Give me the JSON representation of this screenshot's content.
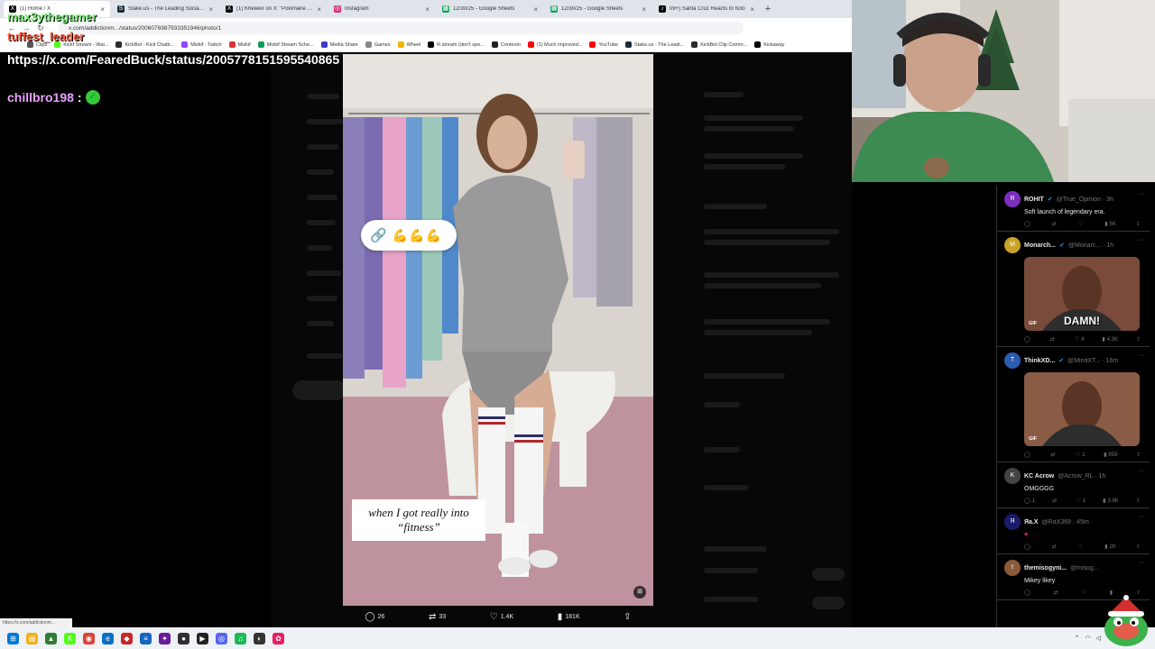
{
  "browser": {
    "tabs": [
      {
        "title": "(1) Home / X",
        "fav": "X",
        "color": "#000"
      },
      {
        "title": "Stake.us - The Leading Social C",
        "fav": "S",
        "color": "#1a2c38"
      },
      {
        "title": "(1) Kheweir on X: \"Pokimane say",
        "fav": "X",
        "color": "#000"
      },
      {
        "title": "Instagram",
        "fav": "◎",
        "color": "#d62976"
      },
      {
        "title": "12/30/25 - Google Sheets",
        "fav": "▦",
        "color": "#0f9d58"
      },
      {
        "title": "12/30/25 - Google Sheets",
        "fav": "▦",
        "color": "#0f9d58"
      },
      {
        "title": "09+) Santa Cruz Reacts to N3o",
        "fav": "♪",
        "color": "#000"
      }
    ],
    "new_tab": "+",
    "close_glyph": "×",
    "url": "x.com/addictionm.../status/2006076987933351946/photo/1",
    "bookmarks": [
      {
        "label": "Clips",
        "color": "#555"
      },
      {
        "label": "Kickf Stream - Wat...",
        "color": "#53fc18"
      },
      {
        "label": "KickBot - Kick Chatb...",
        "color": "#2b2b2b"
      },
      {
        "label": "Mizkif - Twitch",
        "color": "#9146ff"
      },
      {
        "label": "Mizkif",
        "color": "#d33"
      },
      {
        "label": "Mizkif Stream Sche...",
        "color": "#0f9d58"
      },
      {
        "label": "Media Share",
        "color": "#3b3bbd"
      },
      {
        "label": "Games",
        "color": "#888"
      },
      {
        "label": "Wheel",
        "color": "#f4b400"
      },
      {
        "label": "R.stream (don't ope...",
        "color": "#000"
      },
      {
        "label": "Contexto",
        "color": "#222"
      },
      {
        "label": "(1) Much improved...",
        "color": "#ff0000"
      },
      {
        "label": "YouTube",
        "color": "#ff0000"
      },
      {
        "label": "Stake.us - The Leadi...",
        "color": "#1a2c38"
      },
      {
        "label": "KickBot Clip Comm...",
        "color": "#2b2b2b"
      },
      {
        "label": "Kickaway",
        "color": "#000"
      }
    ]
  },
  "overlay_chat": {
    "user1": "max3ythegamer",
    "user2": "tuffest_leader",
    "message_url": "https://x.com/FearedBuck/status/2005778151595540865",
    "user3": "chillbro198",
    "colon": ":",
    "close_mark": "×"
  },
  "viewer": {
    "caption": "when I got really into “fitness”",
    "emoji_link": "🔗",
    "emoji_arms": "💪💪💪",
    "alt": "⊞",
    "actions": {
      "replies": "26",
      "reposts": "33",
      "likes": "1.4K",
      "views": "181K"
    }
  },
  "timeline": {
    "posts": [
      {
        "name": "ROHIT",
        "verified": true,
        "handle": "@True_Opinion · 3h",
        "text": "Soft launch of legendary era.",
        "avatar_color": "#7b2fbe",
        "avatar": "R",
        "media": null,
        "stats": [
          "",
          "",
          "",
          "5K"
        ]
      },
      {
        "name": "Monarch...",
        "verified": true,
        "handle": "@Monarc... · 1h",
        "text": "",
        "avatar_color": "#c9a227",
        "avatar": "M",
        "media": {
          "type": "gif",
          "caption": "DAMN!",
          "color": "#7a4a3a"
        },
        "stats": [
          "",
          "",
          "4",
          "4.3K"
        ]
      },
      {
        "name": "ThinkXD...",
        "verified": true,
        "handle": "@MindXT... · 16m",
        "text": "",
        "avatar_color": "#2a5db0",
        "avatar": "T",
        "media": {
          "type": "gif",
          "caption": "",
          "color": "#8a5b45"
        },
        "stats": [
          "",
          "",
          "1",
          "959"
        ]
      },
      {
        "name": "KC Acrow",
        "verified": false,
        "handle": "@Acrow_RL · 1h",
        "text": "OMGGGG",
        "avatar_color": "#444",
        "avatar": "K",
        "media": null,
        "stats": [
          "1",
          "",
          "1",
          "3.6K"
        ]
      },
      {
        "name": "Яa.X",
        "verified": false,
        "handle": "@RaX369 · 45m",
        "text": "♥",
        "avatar_color": "#1b1b6b",
        "avatar": "Я",
        "media": null,
        "stats": [
          "",
          "",
          "",
          "2K"
        ]
      },
      {
        "name": "themisogyni...",
        "verified": false,
        "handle": "@misog...",
        "text": "Mikey likey",
        "avatar_color": "#8a5a3a",
        "avatar": "t",
        "media": null,
        "stats": [
          "",
          "",
          "",
          ""
        ]
      }
    ],
    "gif_label": "GIF",
    "more": "···"
  },
  "statusbar": {
    "hint": "https://x.com/addictionm..."
  },
  "taskbar": {
    "icons": [
      {
        "name": "windows",
        "glyph": "⊞",
        "color": "#0078d4"
      },
      {
        "name": "file-explorer",
        "glyph": "▤",
        "color": "#f2b01e"
      },
      {
        "name": "app-green",
        "glyph": "▲",
        "color": "#2e7d32"
      },
      {
        "name": "app-kick",
        "glyph": "K",
        "color": "#53fc18"
      },
      {
        "name": "chrome",
        "glyph": "◉",
        "color": "#db4437"
      },
      {
        "name": "edge",
        "glyph": "e",
        "color": "#0b6fc6"
      },
      {
        "name": "app-red",
        "glyph": "◆",
        "color": "#c62828"
      },
      {
        "name": "app-blue",
        "glyph": "≡",
        "color": "#1565c0"
      },
      {
        "name": "app-purple",
        "glyph": "✦",
        "color": "#6a1b9a"
      },
      {
        "name": "obs",
        "glyph": "●",
        "color": "#302e31"
      },
      {
        "name": "terminal",
        "glyph": "▶",
        "color": "#222"
      },
      {
        "name": "discord",
        "glyph": "◎",
        "color": "#5865f2"
      },
      {
        "name": "spotify",
        "glyph": "♫",
        "color": "#1db954"
      },
      {
        "name": "app-dark",
        "glyph": "◐",
        "color": "#333"
      },
      {
        "name": "app-multicolor",
        "glyph": "✿",
        "color": "#e91e63"
      }
    ]
  }
}
